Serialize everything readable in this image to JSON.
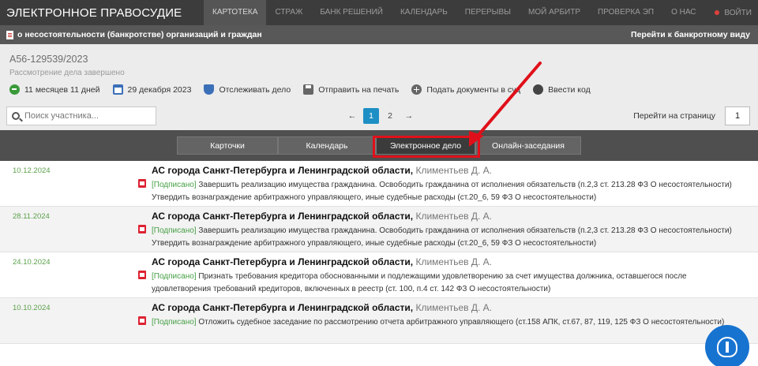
{
  "topnav": {
    "logo": "ЭЛЕКТРОННОЕ ПРАВОСУДИЕ",
    "items": [
      "КАРТОТЕКА",
      "СТРАЖ",
      "БАНК РЕШЕНИЙ",
      "КАЛЕНДАРЬ",
      "ПЕРЕРЫВЫ",
      "МОЙ АРБИТР",
      "ПРОВЕРКА ЭП",
      "О НАС"
    ],
    "login": "ВОЙТИ"
  },
  "subbar": {
    "title": "о несостоятельности (банкротстве) организаций и граждан",
    "right_link": "Перейти к банкротному виду"
  },
  "case": {
    "number": "А56-129539/2023",
    "status": "Рассмотрение дела завершено",
    "actions": {
      "duration": "11 месяцев 11 дней",
      "date": "29 декабря 2023",
      "track": "Отслеживать дело",
      "print": "Отправить на печать",
      "submit": "Подать документы в суд",
      "code": "Ввести код"
    }
  },
  "search": {
    "placeholder": "Поиск участника..."
  },
  "pager": {
    "prev": "←",
    "pages": [
      "1",
      "2"
    ],
    "next": "→",
    "goto_label": "Перейти на страницу",
    "goto_value": "1"
  },
  "tabs": [
    "Карточки",
    "Календарь",
    "Электронное дело",
    "Онлайн-заседания"
  ],
  "records": [
    {
      "date": "10.12.2024",
      "court": "АС города Санкт-Петербурга и Ленинградской области,",
      "judge": "Климентьев Д. А.",
      "signed": "[Подписано]",
      "text": "Завершить реализацию имущества гражданина. Освободить гражданина от исполнения обязательств (п.2,3 ст. 213.28 ФЗ О несостоятельности) Утвердить вознаграждение арбитражного управляющего, иные судебные расходы (ст.20_6, 59 ФЗ О несостоятельности)"
    },
    {
      "date": "28.11.2024",
      "court": "АС города Санкт-Петербурга и Ленинградской области,",
      "judge": "Климентьев Д. А.",
      "signed": "[Подписано]",
      "text": "Завершить реализацию имущества гражданина. Освободить гражданина от исполнения обязательств (п.2,3 ст. 213.28 ФЗ О несостоятельности) Утвердить вознаграждение арбитражного управляющего, иные судебные расходы (ст.20_6, 59 ФЗ О несостоятельности)"
    },
    {
      "date": "24.10.2024",
      "court": "АС города Санкт-Петербурга и Ленинградской области,",
      "judge": "Климентьев Д. А.",
      "signed": "[Подписано]",
      "text": "Признать требования кредитора обоснованными и подлежащими удовлетворению за счет имущества должника, оставшегося после удовлетворения требований кредиторов, включенных в реестр (ст. 100, п.4 ст. 142 ФЗ О несостоятельности)"
    },
    {
      "date": "10.10.2024",
      "court": "АС города Санкт-Петербурга и Ленинградской области,",
      "judge": "Климентьев Д. А.",
      "signed": "[Подписано]",
      "text": "Отложить судебное заседание по рассмотрению отчета арбитражного управляющего (ст.158 АПК, ст.67, 87, 119, 125 ФЗ О несостоятельности)"
    }
  ],
  "colors": {
    "accent": "#1e8fc4",
    "highlight": "#e0101a",
    "signed": "#46a046"
  },
  "icons": [
    "clock-icon",
    "calendar-icon",
    "shield-icon",
    "printer-icon",
    "plus-icon",
    "key-icon",
    "search-icon",
    "pdf-icon",
    "emblem-icon"
  ]
}
